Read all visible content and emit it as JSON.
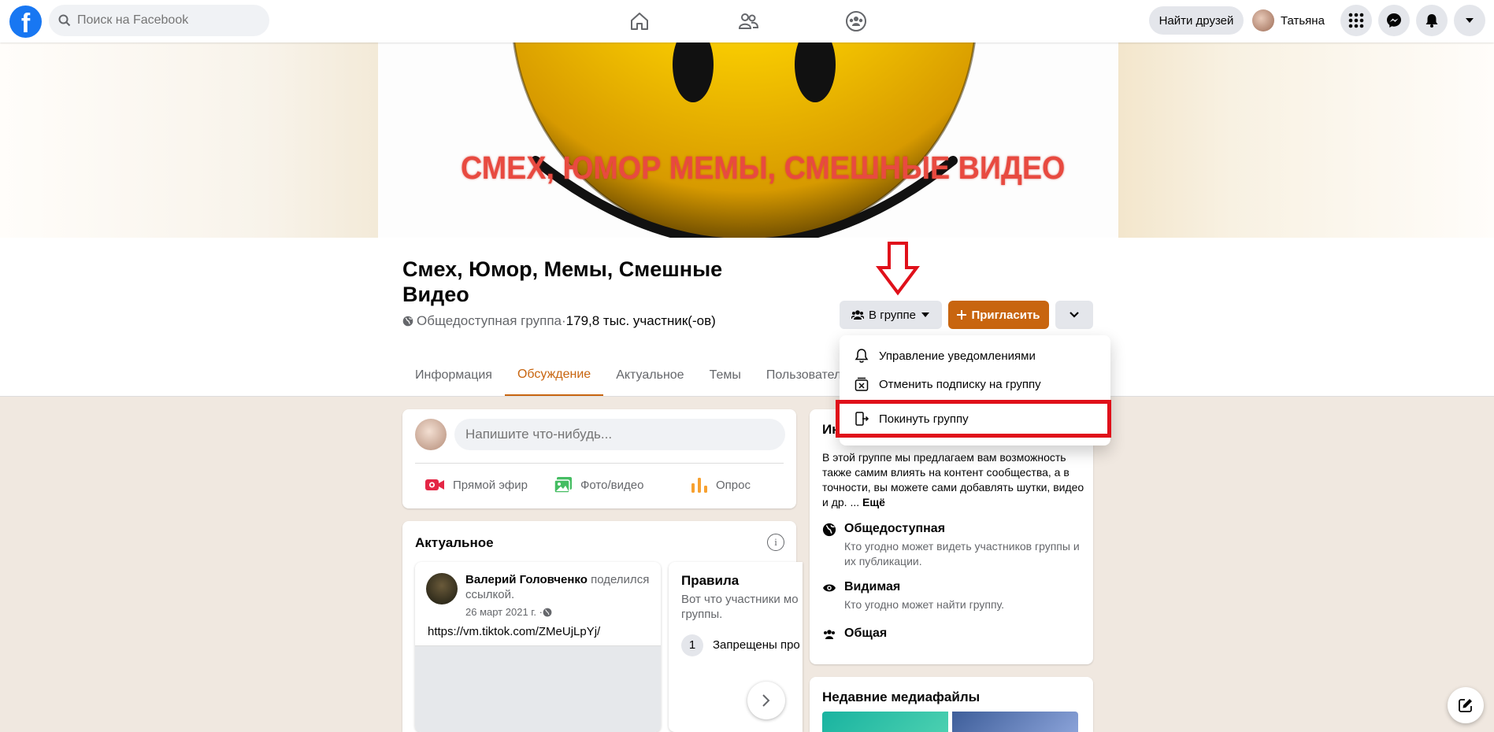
{
  "header": {
    "logo_letter": "f",
    "search_placeholder": "Поиск на Facebook",
    "nav_icons": [
      "home-icon",
      "friends-icon",
      "groups-icon"
    ],
    "find_friends_label": "Найти друзей",
    "profile_name": "Татьяна",
    "right_icons": [
      "menu-grid-icon",
      "messenger-icon",
      "notifications-icon",
      "account-chevron-icon"
    ]
  },
  "cover": {
    "banner_text": "СМЕХ, ЮМОР МЕМЫ, СМЕШНЫЕ ВИДЕО"
  },
  "group": {
    "title": "Смех, Юмор, Мемы, Смешные Видео",
    "privacy": "Общедоступная группа",
    "separator": " · ",
    "members": "179,8 тыс. участник(-ов)",
    "joined_label": "В группе",
    "invite_label": "Пригласить"
  },
  "tabs": [
    "Информация",
    "Обсуждение",
    "Актуальное",
    "Темы",
    "Пользователи"
  ],
  "active_tab": "Обсуждение",
  "dropdown": {
    "items": [
      "Управление уведомлениями",
      "Отменить подписку на группу",
      "Покинуть группу"
    ],
    "highlighted": "Покинуть группу"
  },
  "composer": {
    "placeholder": "Напишите что-нибудь...",
    "live_label": "Прямой эфир",
    "photo_label": "Фото/видео",
    "poll_label": "Опрос"
  },
  "actual": {
    "title": "Актуальное",
    "info_icon": "i",
    "post": {
      "author": "Валерий Головченко",
      "action": " поделился ссылкой.",
      "date": "26 март 2021 г. · ",
      "link": "https://vm.tiktok.com/ZMeUjLpYj/"
    },
    "rules": {
      "title": "Правила",
      "desc": "Вот что участники мо группы.",
      "rule_number": "1",
      "rule_text": "Запрещены про"
    }
  },
  "about": {
    "title_visible": "Ин",
    "description": "В этой группе мы предлагаем вам возможность также самим влиять на контент сообщества, а в точности, вы можете сами добавлять шутки, видео и др. ...",
    "more": "Ещё",
    "public_title": "Общедоступная",
    "public_desc": "Кто угодно может видеть участников группы и их публикации.",
    "visible_title": "Видимая",
    "visible_desc": "Кто угодно может найти группу.",
    "general_title": "Общая"
  },
  "media": {
    "title": "Недавние медиафайлы"
  },
  "colors": {
    "brand": "#1877f2",
    "accent": "#c8650f",
    "highlight": "#e0101a"
  }
}
